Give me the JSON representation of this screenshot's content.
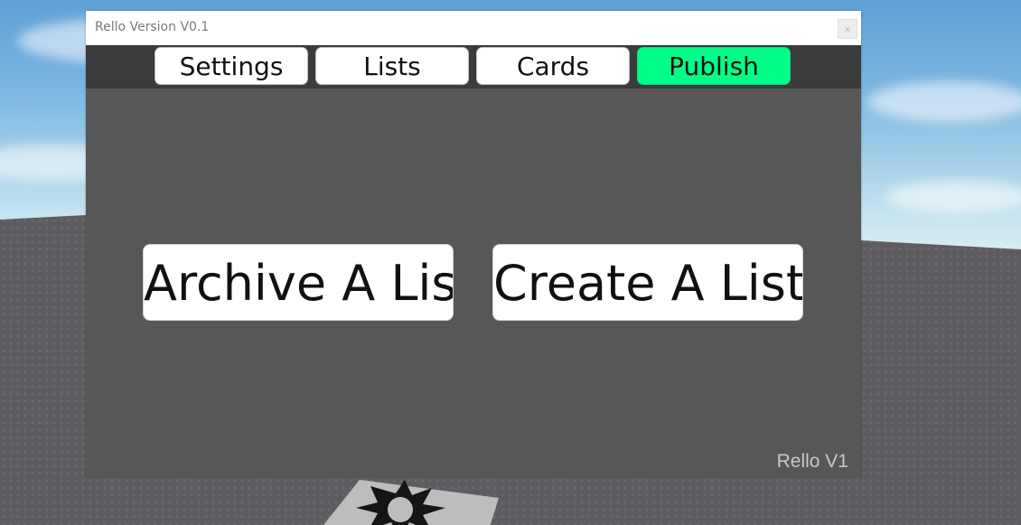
{
  "window": {
    "title": "Rello Version V0.1",
    "close_label": "×"
  },
  "tabs": [
    {
      "label": "Settings"
    },
    {
      "label": "Lists"
    },
    {
      "label": "Cards"
    },
    {
      "label": "Publish",
      "active": true
    }
  ],
  "main": {
    "archive_label": "Archive A List",
    "create_label": "Create A List"
  },
  "footer": {
    "version_text": "Rello V1"
  },
  "colors": {
    "active_tab": "#00ff88",
    "panel": "#575757",
    "tabbar": "#3b3b3b"
  }
}
